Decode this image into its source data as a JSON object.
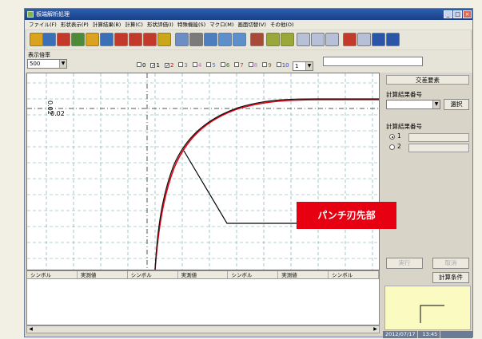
{
  "window": {
    "title": "板端解析処理",
    "controls": [
      "_",
      "□",
      "×"
    ]
  },
  "menubar": {
    "items": [
      "ファイル(F)",
      "形状表示(P)",
      "計算結果(B)",
      "計算(C)",
      "形状評価(I)",
      "特殊機能(S)",
      "マクロ(M)",
      "画面切替(V)",
      "その他(O)"
    ]
  },
  "toolbar": {
    "buttons": [
      {
        "icon": "open-folder-icon",
        "color": "#d9a21f"
      },
      {
        "icon": "save-disk-icon",
        "color": "#3b6fb6"
      },
      {
        "icon": "record-icon",
        "color": "#c23a2b"
      },
      {
        "icon": "chart-icon",
        "color": "#4d8a3a"
      },
      {
        "icon": "open-folder-icon",
        "color": "#d9a21f"
      },
      {
        "icon": "save-disk-icon",
        "color": "#3b6fb6"
      },
      {
        "icon": "cross-icon",
        "color": "#c23a2b"
      },
      {
        "icon": "cross-icon",
        "color": "#c23a2b"
      },
      {
        "icon": "cross-icon",
        "color": "#c23a2b"
      },
      {
        "icon": "measure-icon",
        "color": "#c9a61a"
      },
      {
        "icon": "pointer-icon",
        "color": "#6c8ec4"
      },
      {
        "icon": "print-icon",
        "color": "#7b7b7b"
      },
      {
        "icon": "picture-icon",
        "color": "#4d7fbf"
      },
      {
        "icon": "bmp-icon",
        "color": "#5e8fcb"
      },
      {
        "icon": "bmp-icon",
        "color": "#5e8fcb"
      },
      {
        "icon": "export-icon",
        "color": "#a64a3a"
      },
      {
        "icon": "chart-icon",
        "color": "#9aa83a"
      },
      {
        "icon": "chart-icon",
        "color": "#9aa83a"
      },
      {
        "icon": "line-icon",
        "color": "#b8c0d8"
      },
      {
        "icon": "line-icon",
        "color": "#b8c0d8"
      },
      {
        "icon": "line-icon",
        "color": "#b8c0d8"
      },
      {
        "icon": "shape-icon",
        "color": "#c23a2b"
      },
      {
        "icon": "undo-icon",
        "color": "#b8c0d8"
      },
      {
        "icon": "window-icon",
        "color": "#2b56a8"
      },
      {
        "icon": "window-icon",
        "color": "#2b56a8"
      }
    ]
  },
  "zoom": {
    "label": "表示倍率",
    "value": "500"
  },
  "layers": [
    {
      "num": "0",
      "checked": false,
      "color": "#000000"
    },
    {
      "num": "1",
      "checked": true,
      "color": "#000000"
    },
    {
      "num": "2",
      "checked": true,
      "color": "#e60012"
    },
    {
      "num": "3",
      "checked": false,
      "color": "#9b59b6"
    },
    {
      "num": "4",
      "checked": false,
      "color": "#c06bd4"
    },
    {
      "num": "5",
      "checked": false,
      "color": "#3a7bd5"
    },
    {
      "num": "6",
      "checked": false,
      "color": "#2a6a2a"
    },
    {
      "num": "7",
      "checked": false,
      "color": "#c23a2b"
    },
    {
      "num": "8",
      "checked": false,
      "color": "#c06bd4"
    },
    {
      "num": "9",
      "checked": false,
      "color": "#7a6a2a"
    },
    {
      "num": "10",
      "checked": false,
      "color": "#3a3ad5"
    }
  ],
  "layer_select": "1",
  "plot": {
    "y_label_vertical": "0.02",
    "y_label": "0.02"
  },
  "table": {
    "headers": [
      "シンボル",
      "実測値",
      "シンボル",
      "実測値",
      "シンボル",
      "実測値",
      "シンボル"
    ]
  },
  "right_panel": {
    "title": "交差要素",
    "result_no_label": "計算結果番号",
    "select_button": "選択",
    "result_no_label2": "計算結果番号",
    "radio_1": "1",
    "radio_2": "2",
    "run_button": "実行",
    "cancel_button": "取消",
    "conditions_button": "計算条件"
  },
  "status": {
    "date": "2012/07/17",
    "time": "13:45"
  },
  "callout": {
    "text": "パンチ刃先部"
  }
}
